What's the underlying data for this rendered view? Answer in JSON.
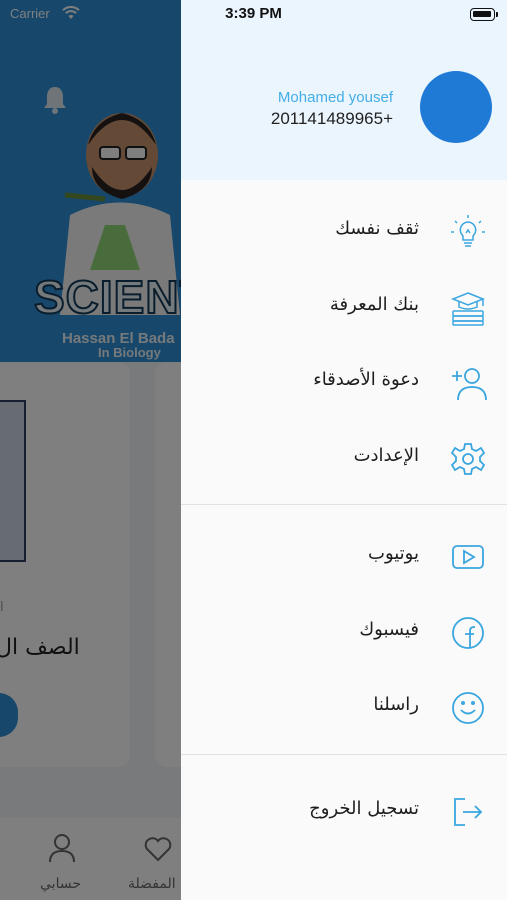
{
  "background_app": {
    "carrier": "Carrier",
    "logo_text": "SCIENTI",
    "logo_sub1": "Hassan El Bada",
    "logo_sub2": "In Biology",
    "card_small_text": "l",
    "card_title": "الصف ال",
    "tabs": [
      {
        "label": "حسابي",
        "icon": "user-icon"
      },
      {
        "label": "المفضلة",
        "icon": "heart-icon"
      }
    ]
  },
  "drawer": {
    "status_time": "3:39 PM",
    "user": {
      "name": "Mohamed yousef",
      "phone": "201141489965+"
    },
    "sections": [
      [
        {
          "label": "ثقف نفسك",
          "icon": "lightbulb-icon"
        },
        {
          "label": "بنك المعرفة",
          "icon": "graduation-books-icon"
        },
        {
          "label": "دعوة الأصدقاء",
          "icon": "add-user-icon"
        },
        {
          "label": "الإعدادت",
          "icon": "gear-icon"
        }
      ],
      [
        {
          "label": "يوتيوب",
          "icon": "youtube-icon"
        },
        {
          "label": "فيسبوك",
          "icon": "facebook-icon"
        },
        {
          "label": "راسلنا",
          "icon": "smile-icon"
        }
      ],
      [
        {
          "label": "تسجيل الخروج",
          "icon": "logout-icon"
        }
      ]
    ]
  },
  "colors": {
    "accent": "#44aee8",
    "icon_blue": "#3aa6e0",
    "avatar": "#1f7ad6",
    "header_bg": "#ebf5fd",
    "hero_bg": "#2e8fd6"
  }
}
